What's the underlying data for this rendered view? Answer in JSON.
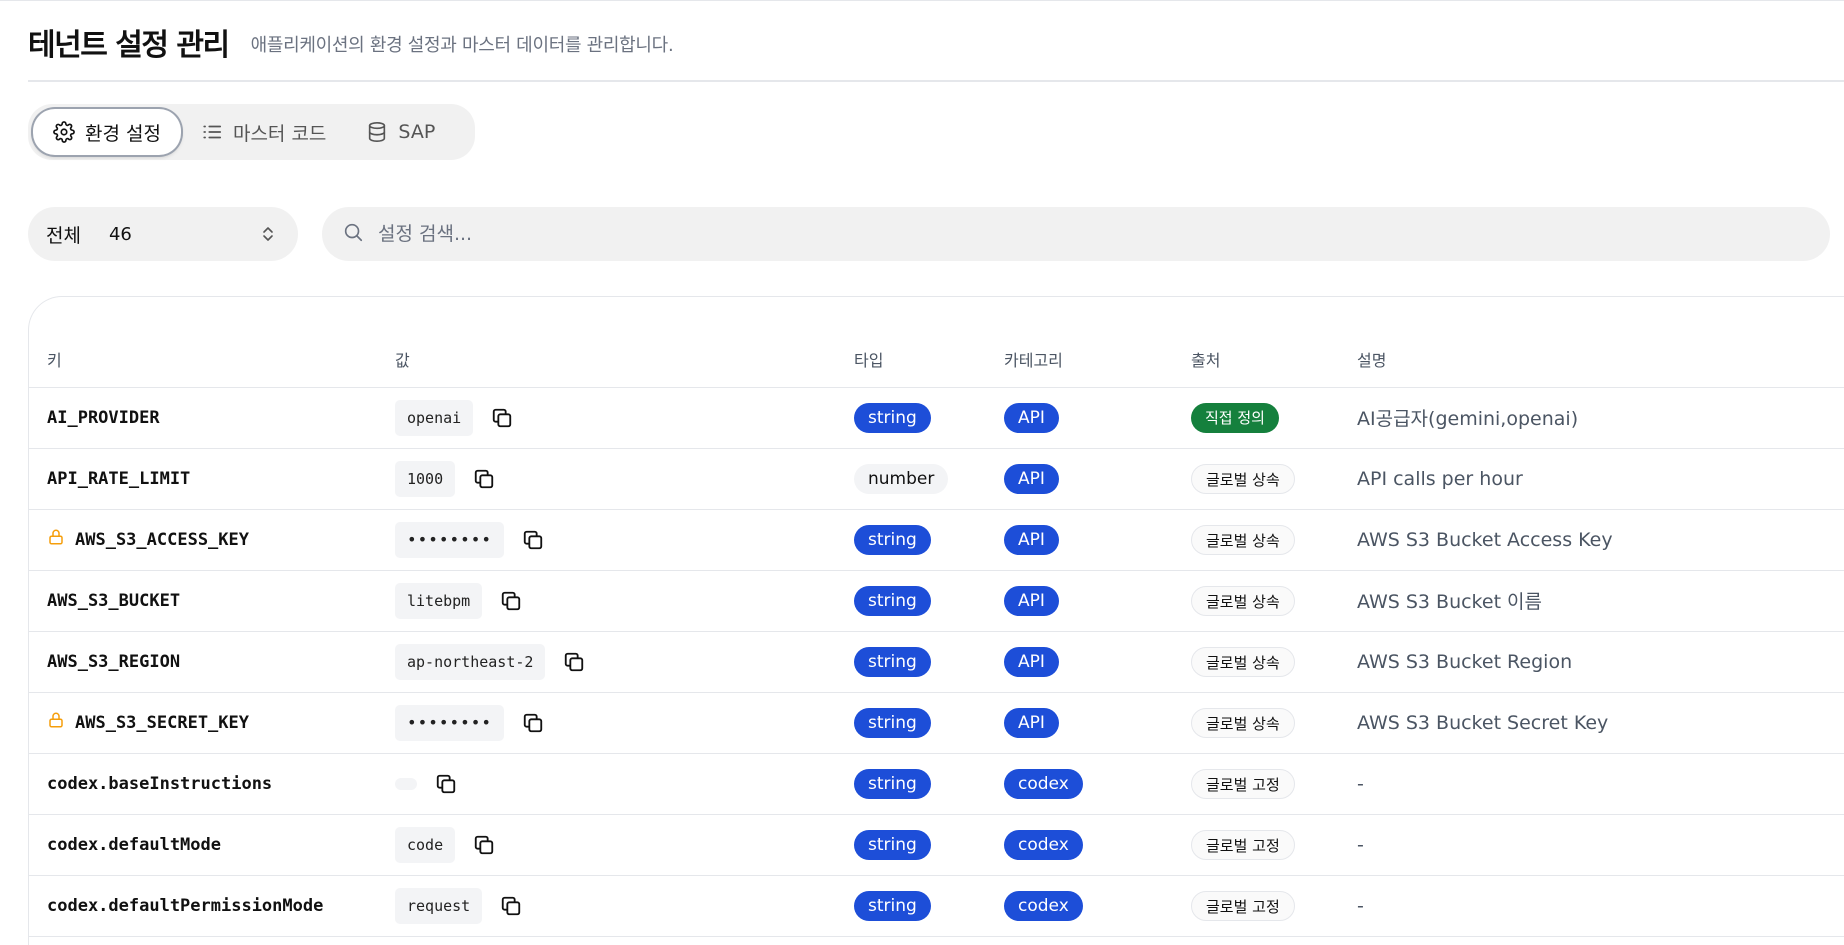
{
  "header": {
    "title": "테넌트 설정 관리",
    "subtitle": "애플리케이션의 환경 설정과 마스터 데이터를 관리합니다."
  },
  "tabs": [
    {
      "label": "환경 설정",
      "icon": "gear-icon",
      "active": true
    },
    {
      "label": "마스터 코드",
      "icon": "list-icon",
      "active": false
    },
    {
      "label": "SAP",
      "icon": "database-icon",
      "active": false
    }
  ],
  "filter": {
    "label": "전체",
    "count": "46"
  },
  "search": {
    "placeholder": "설정 검색..."
  },
  "table": {
    "headers": [
      "키",
      "값",
      "타입",
      "카테고리",
      "출처",
      "설명"
    ],
    "rows": [
      {
        "key": "AI_PROVIDER",
        "locked": false,
        "value": "openai",
        "type": "string",
        "category": "API",
        "source": "직접 정의",
        "source_style": "green",
        "description": "AI공급자(gemini,openai)"
      },
      {
        "key": "API_RATE_LIMIT",
        "locked": false,
        "value": "1000",
        "type": "number",
        "category": "API",
        "source": "글로벌 상속",
        "source_style": "outline",
        "description": "API calls per hour"
      },
      {
        "key": "AWS_S3_ACCESS_KEY",
        "locked": true,
        "value": "••••••••",
        "type": "string",
        "category": "API",
        "source": "글로벌 상속",
        "source_style": "outline",
        "description": "AWS S3 Bucket Access Key"
      },
      {
        "key": "AWS_S3_BUCKET",
        "locked": false,
        "value": "litebpm",
        "type": "string",
        "category": "API",
        "source": "글로벌 상속",
        "source_style": "outline",
        "description": "AWS S3 Bucket 이름"
      },
      {
        "key": "AWS_S3_REGION",
        "locked": false,
        "value": "ap-northeast-2",
        "type": "string",
        "category": "API",
        "source": "글로벌 상속",
        "source_style": "outline",
        "description": "AWS S3 Bucket Region"
      },
      {
        "key": "AWS_S3_SECRET_KEY",
        "locked": true,
        "value": "••••••••",
        "type": "string",
        "category": "API",
        "source": "글로벌 상속",
        "source_style": "outline",
        "description": "AWS S3 Bucket Secret Key"
      },
      {
        "key": "codex.baseInstructions",
        "locked": false,
        "value": "",
        "type": "string",
        "category": "codex",
        "source": "글로벌 고정",
        "source_style": "outline",
        "description": "-"
      },
      {
        "key": "codex.defaultMode",
        "locked": false,
        "value": "code",
        "type": "string",
        "category": "codex",
        "source": "글로벌 고정",
        "source_style": "outline",
        "description": "-"
      },
      {
        "key": "codex.defaultPermissionMode",
        "locked": false,
        "value": "request",
        "type": "string",
        "category": "codex",
        "source": "글로벌 고정",
        "source_style": "outline",
        "description": "-"
      }
    ]
  },
  "colors": {
    "accent_blue": "#1d4ed8",
    "source_green": "#15803d",
    "lock_orange": "#f59e0b"
  }
}
